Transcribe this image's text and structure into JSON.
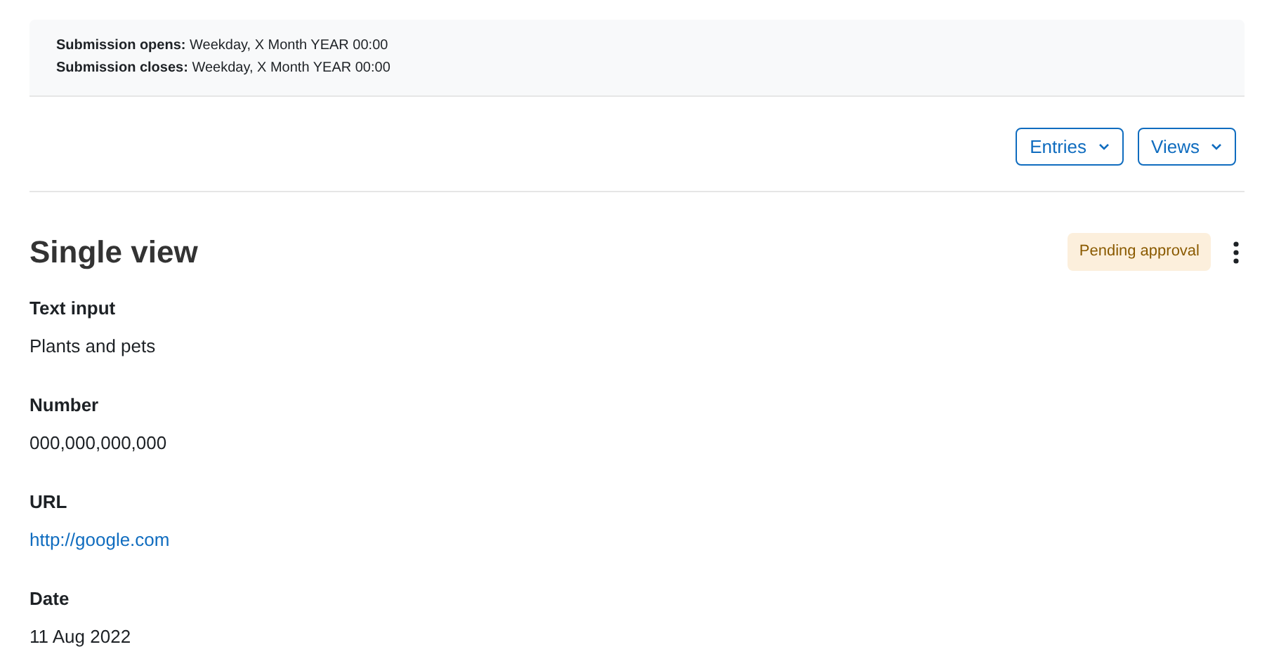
{
  "submission": [
    {
      "label": "Submission opens:",
      "value": "Weekday, X Month YEAR 00:00"
    },
    {
      "label": "Submission closes:",
      "value": "Weekday, X Month YEAR 00:00"
    }
  ],
  "buttons": [
    "Entries",
    "Views"
  ],
  "heading": "Single view",
  "badge": "Pending approval",
  "fields": [
    {
      "label": "Text input",
      "value": "Plants and pets",
      "kind": "text"
    },
    {
      "label": "Number",
      "value": "000,000,000,000",
      "kind": "text"
    },
    {
      "label": "URL",
      "value": "http://google.com",
      "kind": "link"
    },
    {
      "label": "Date",
      "value": "11 Aug 2022",
      "kind": "text"
    }
  ]
}
